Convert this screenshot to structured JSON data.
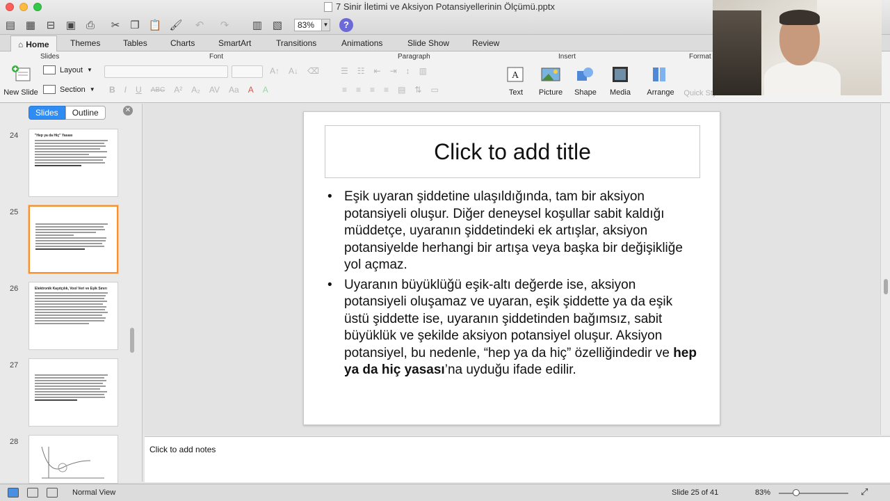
{
  "window": {
    "title": "7 Sinir İletimi ve Aksiyon Potansiyellerinin Ölçümü.pptx",
    "zoom": "83%",
    "help": "?"
  },
  "ribbon": {
    "tabs": [
      "Home",
      "Themes",
      "Tables",
      "Charts",
      "SmartArt",
      "Transitions",
      "Animations",
      "Slide Show",
      "Review"
    ],
    "groups": {
      "slides": "Slides",
      "font": "Font",
      "paragraph": "Paragraph",
      "insert": "Insert",
      "format": "Format"
    },
    "buttons": {
      "new_slide": "New Slide",
      "layout": "Layout",
      "section": "Section",
      "text": "Text",
      "picture": "Picture",
      "shape": "Shape",
      "media": "Media",
      "arrange": "Arrange",
      "quick_styles": "Quick Styles"
    }
  },
  "sidebar": {
    "tab_slides": "Slides",
    "tab_outline": "Outline",
    "thumbnails": [
      {
        "num": "24",
        "title": "\"Hep ya da Hiç\" Yasası"
      },
      {
        "num": "25",
        "title": ""
      },
      {
        "num": "26",
        "title": "Elektronik Kayıtçılık, Vool Veri ve Eşik Sınırı"
      },
      {
        "num": "27",
        "title": ""
      },
      {
        "num": "28",
        "title": ""
      }
    ]
  },
  "slide": {
    "title": "Click to add title",
    "bullet1": "Eşik uyaran şiddetine ulaşıldığında, tam bir aksiyon potansiyeli oluşur. Diğer deneysel koşullar sabit kaldığı müddetçe, uyaranın şiddetindeki ek artışlar, aksiyon potansiyelde herhangi bir artışa veya başka bir değişikliğe yol açmaz.",
    "bullet2_start": "Uyaranın büyüklüğü eşik-altı değerde ise, aksiyon potansiyeli oluşamaz ve uyaran, eşik şiddette ya da eşik üstü şiddette ise, uyaranın şiddetinden bağımsız, sabit büyüklük ve şekilde aksiyon potansiyel oluşur. Aksiyon potansiyel, bu nedenle, “hep ya da hiç” özelliğindedir ve ",
    "bullet2_bold": "hep ya da hiç yasası",
    "bullet2_end": "’na uyduğu ifade edilir."
  },
  "notes": {
    "placeholder": "Click to add notes"
  },
  "status": {
    "view": "Normal View",
    "slide_pos": "Slide 25 of 41",
    "zoom": "83%"
  },
  "colors": {
    "accent": "#2f8cf2",
    "selection": "#f7902d"
  }
}
